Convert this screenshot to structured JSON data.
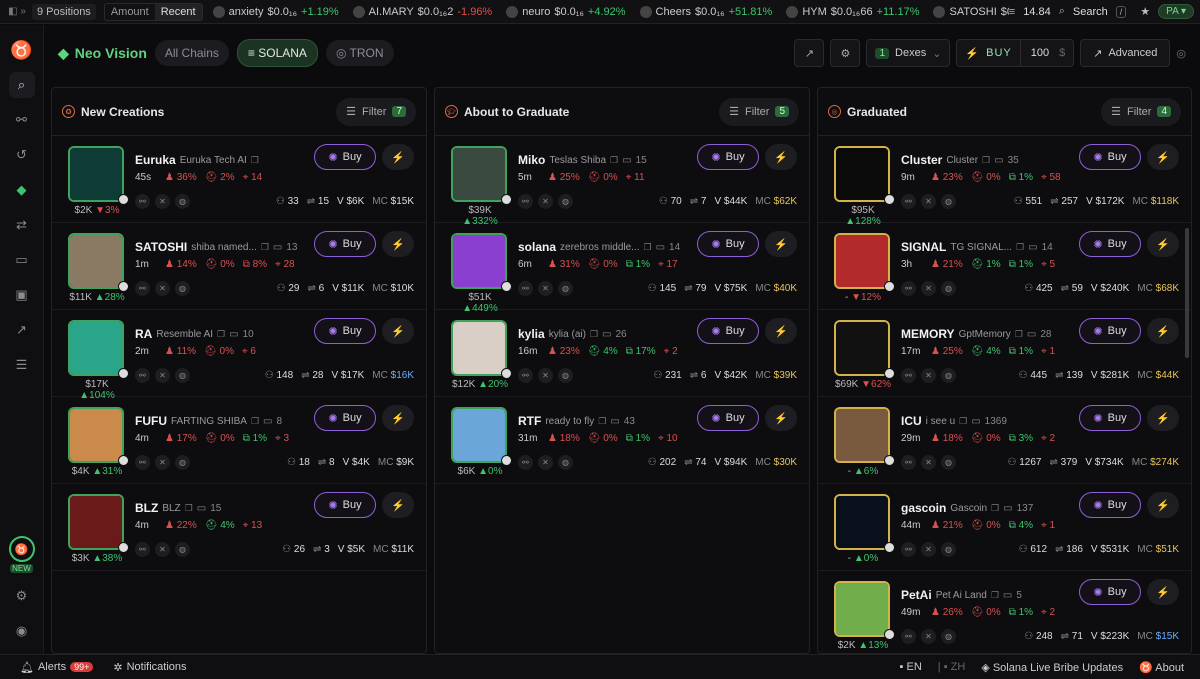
{
  "topbar": {
    "positions": "9 Positions",
    "amount": "Amount",
    "recent": "Recent",
    "ticker": [
      {
        "name": "anxiety",
        "price": "$0.0₁₆",
        "change": "+1.19%",
        "dir": "up"
      },
      {
        "name": "AI.MARY",
        "price": "$0.0₁₆2",
        "change": "-1.96%",
        "dir": "dn"
      },
      {
        "name": "neuro",
        "price": "$0.0₁₆",
        "change": "+4.92%",
        "dir": "up"
      },
      {
        "name": "Cheers",
        "price": "$0.0₁₆",
        "change": "+51.81%",
        "dir": "up"
      },
      {
        "name": "HYM",
        "price": "$0.0₁₆66",
        "change": "+11.17%",
        "dir": "up"
      },
      {
        "name": "SATOSHI",
        "price": "$0.2",
        "change": "",
        "dir": "up"
      }
    ],
    "balance": "14.84",
    "search": "Search",
    "search_kbd": "/",
    "profile": "PA"
  },
  "subbar": {
    "brand": "Neo Vision",
    "chains": [
      "All Chains",
      "SOLANA",
      "TRON"
    ],
    "dexes_count": "1",
    "dexes": "Dexes",
    "buy": "BUY",
    "amount": "100",
    "currency": "$",
    "advanced": "Advanced"
  },
  "columns": [
    {
      "title": "New Creations",
      "filter": "Filter",
      "filter_count": "7",
      "cards": [
        {
          "name": "Euruka",
          "sub": "Euruka Tech AI",
          "comments": "",
          "age": "45s",
          "h": "36%",
          "d": "2%",
          "sn": "",
          "x": "14",
          "mc_under": "$2K",
          "chg": "3%",
          "cdir": "d",
          "holders": "33",
          "tx": "15",
          "vol": "V $6K",
          "mc": "$15K",
          "mcc": "w",
          "bg": "#0f3b37"
        },
        {
          "name": "SATOSHI",
          "sub": "shiba named...",
          "comments": "13",
          "age": "1m",
          "h": "14%",
          "d": "0%",
          "sn": "8%",
          "x": "28",
          "mc_under": "$11K",
          "chg": "28%",
          "cdir": "u",
          "holders": "29",
          "tx": "6",
          "vol": "V $11K",
          "mc": "$10K",
          "mcc": "w",
          "bg": "#8a7a64"
        },
        {
          "name": "RA",
          "sub": "Resemble AI",
          "comments": "10",
          "age": "2m",
          "h": "11%",
          "d": "0%",
          "sn": "",
          "x": "6",
          "mc_under": "$17K",
          "chg": "104%",
          "cdir": "u",
          "holders": "148",
          "tx": "28",
          "vol": "V $17K",
          "mc": "$16K",
          "mcc": "b",
          "bg": "#2aa58a"
        },
        {
          "name": "FUFU",
          "sub": "FARTING SHIBA",
          "comments": "8",
          "age": "4m",
          "h": "17%",
          "d": "0%",
          "sn": "1%",
          "x": "3",
          "mc_under": "$4K",
          "chg": "31%",
          "cdir": "u",
          "holders": "18",
          "tx": "8",
          "vol": "V $4K",
          "mc": "$9K",
          "mcc": "w",
          "bg": "#c98a4c"
        },
        {
          "name": "BLZ",
          "sub": "BLZ",
          "comments": "15",
          "age": "4m",
          "h": "22%",
          "d": "4%",
          "sn": "",
          "x": "13",
          "mc_under": "$3K",
          "chg": "38%",
          "cdir": "u",
          "holders": "26",
          "tx": "3",
          "vol": "V $5K",
          "mc": "$11K",
          "mcc": "w",
          "bg": "#6b1a1a"
        }
      ]
    },
    {
      "title": "About to Graduate",
      "filter": "Filter",
      "filter_count": "5",
      "cards": [
        {
          "name": "Miko",
          "sub": "Teslas Shiba",
          "comments": "15",
          "age": "5m",
          "h": "25%",
          "d": "0%",
          "sn": "",
          "x": "11",
          "mc_under": "$39K",
          "chg": "332%",
          "cdir": "u",
          "holders": "70",
          "tx": "7",
          "vol": "V $44K",
          "mc": "$62K",
          "mcc": "y",
          "bg": "#3a4a40"
        },
        {
          "name": "solana",
          "sub": "zerebros middle...",
          "comments": "14",
          "age": "6m",
          "h": "31%",
          "d": "0%",
          "sn": "1%",
          "x": "17",
          "mc_under": "$51K",
          "chg": "449%",
          "cdir": "u",
          "holders": "145",
          "tx": "79",
          "vol": "V $75K",
          "mc": "$40K",
          "mcc": "y",
          "bg": "#8a3fd1"
        },
        {
          "name": "kylia",
          "sub": "kylia (ai)",
          "comments": "26",
          "age": "16m",
          "h": "23%",
          "d": "4%",
          "sn": "17%",
          "x": "2",
          "mc_under": "$12K",
          "chg": "20%",
          "cdir": "u",
          "holders": "231",
          "tx": "6",
          "vol": "V $42K",
          "mc": "$39K",
          "mcc": "y",
          "bg": "#d9cfc7"
        },
        {
          "name": "RTF",
          "sub": "ready to fly",
          "comments": "43",
          "age": "31m",
          "h": "18%",
          "d": "0%",
          "sn": "1%",
          "x": "10",
          "mc_under": "$6K",
          "chg": "0%",
          "cdir": "u",
          "holders": "202",
          "tx": "74",
          "vol": "V $94K",
          "mc": "$30K",
          "mcc": "y",
          "bg": "#6aa7d8"
        }
      ]
    },
    {
      "title": "Graduated",
      "filter": "Filter",
      "filter_count": "4",
      "cards": [
        {
          "name": "Cluster",
          "sub": "Cluster",
          "comments": "35",
          "age": "9m",
          "h": "23%",
          "d": "0%",
          "sn": "1%",
          "x": "58",
          "mc_under": "$95K",
          "chg": "128%",
          "cdir": "u",
          "holders": "551",
          "tx": "257",
          "vol": "V $172K",
          "mc": "$118K",
          "mcc": "y",
          "bg": "#0a0a0a"
        },
        {
          "name": "SIGNAL",
          "sub": "TG SIGNAL...",
          "comments": "14",
          "age": "3h",
          "h": "21%",
          "d": "1%",
          "sn": "1%",
          "x": "5",
          "mc_under": "-",
          "chg": "12%",
          "cdir": "d",
          "holders": "425",
          "tx": "59",
          "vol": "V $240K",
          "mc": "$68K",
          "mcc": "y",
          "bg": "#b22a2a"
        },
        {
          "name": "MEMORY",
          "sub": "GptMemory",
          "comments": "28",
          "age": "17m",
          "h": "25%",
          "d": "4%",
          "sn": "1%",
          "x": "1",
          "mc_under": "$69K",
          "chg": "62%",
          "cdir": "d",
          "holders": "445",
          "tx": "139",
          "vol": "V $281K",
          "mc": "$44K",
          "mcc": "y",
          "bg": "#111111"
        },
        {
          "name": "ICU",
          "sub": "i see u",
          "comments": "1369",
          "age": "29m",
          "h": "18%",
          "d": "0%",
          "sn": "3%",
          "x": "2",
          "mc_under": "-",
          "chg": "6%",
          "cdir": "u",
          "holders": "1267",
          "tx": "379",
          "vol": "V $734K",
          "mc": "$274K",
          "mcc": "y",
          "bg": "#7a5a3e"
        },
        {
          "name": "gascoin",
          "sub": "Gascoin",
          "comments": "137",
          "age": "44m",
          "h": "21%",
          "d": "0%",
          "sn": "4%",
          "x": "1",
          "mc_under": "-",
          "chg": "0%",
          "cdir": "u",
          "holders": "612",
          "tx": "186",
          "vol": "V $531K",
          "mc": "$51K",
          "mcc": "y",
          "bg": "#0a0f1c"
        },
        {
          "name": "PetAi",
          "sub": "Pet Ai Land",
          "comments": "5",
          "age": "49m",
          "h": "26%",
          "d": "0%",
          "sn": "1%",
          "x": "2",
          "mc_under": "$2K",
          "chg": "13%",
          "cdir": "u",
          "holders": "248",
          "tx": "71",
          "vol": "V $223K",
          "mc": "$15K",
          "mcc": "b",
          "bg": "#6fae4a"
        }
      ]
    }
  ],
  "card_labels": {
    "buy": "Buy",
    "mc": "MC"
  },
  "footer": {
    "alerts": "Alerts",
    "alerts_count": "99+",
    "notifications": "Notifications",
    "lang_en": "EN",
    "lang_zh": "ZH",
    "bribe": "Solana Live Bribe Updates",
    "about": "About"
  }
}
